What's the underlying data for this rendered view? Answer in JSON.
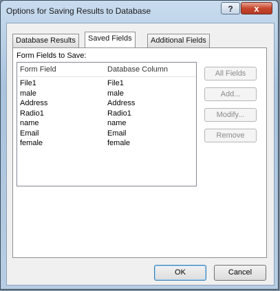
{
  "window": {
    "title": "Options for Saving Results to Database",
    "help_label": "?",
    "close_label": "x"
  },
  "tabs": [
    {
      "label": "Database Results",
      "active": false
    },
    {
      "label": "Saved Fields",
      "active": true
    },
    {
      "label": "Additional Fields",
      "active": false
    }
  ],
  "panel": {
    "section_label": "Form Fields to Save:",
    "columns": [
      "Form Field",
      "Database Column"
    ],
    "rows": [
      {
        "form_field": "File1",
        "db_column": "File1"
      },
      {
        "form_field": "male",
        "db_column": "male"
      },
      {
        "form_field": "Address",
        "db_column": "Address"
      },
      {
        "form_field": "Radio1",
        "db_column": "Radio1"
      },
      {
        "form_field": "name",
        "db_column": "name"
      },
      {
        "form_field": "Email",
        "db_column": "Email"
      },
      {
        "form_field": "female",
        "db_column": "female"
      }
    ],
    "buttons": {
      "all_fields": "All Fields",
      "add": "Add...",
      "modify": "Modify...",
      "remove": "Remove"
    }
  },
  "footer": {
    "ok": "OK",
    "cancel": "Cancel"
  }
}
